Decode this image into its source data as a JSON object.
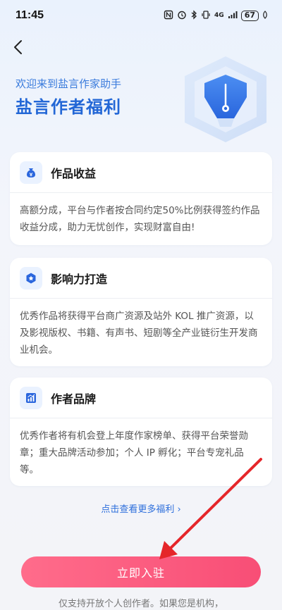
{
  "status_bar": {
    "time": "11:45",
    "network": "4G",
    "battery": "67",
    "icons": [
      "nfc-icon",
      "alarm-icon",
      "bluetooth-icon",
      "vibrate-icon",
      "signal-icon",
      "battery-icon"
    ]
  },
  "header": {
    "subtitle": "欢迎来到盐言作家助手",
    "title": "盐言作者福利",
    "accent_color": "#2367d6"
  },
  "cards": [
    {
      "icon": "money-bag-icon",
      "title": "作品收益",
      "body": "高额分成，平台与作者按合同约定50%比例获得签约作品收益分成，助力无忧创作，实现财富自由!"
    },
    {
      "icon": "influence-hex-icon",
      "title": "影响力打造",
      "body": "优秀作品将获得平台商广资源及站外 KOL 推广资源，以及影视版权、书籍、有声书、短剧等全产业链衍生开发商业机会。"
    },
    {
      "icon": "chart-bars-icon",
      "title": "作者品牌",
      "body": "优秀作者将有机会登上年度作家榜单、获得平台荣誉勋章；重大品牌活动参加；个人 IP 孵化；平台专宠礼品等。"
    }
  ],
  "more_link": "点击查看更多福利 ›",
  "cta": {
    "label": "立即入驻",
    "color": "#f84e76"
  },
  "footnote": "仅支持开放个人创作者。如果您是机构，"
}
